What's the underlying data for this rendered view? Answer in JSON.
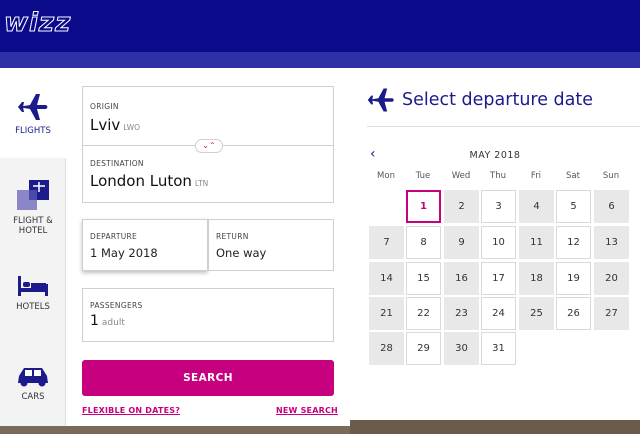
{
  "brand": {
    "logo_text": "wizz"
  },
  "colors": {
    "header": "#0a0a8a",
    "accent": "#c6007e",
    "brand_text": "#1b1b8c"
  },
  "sidebar": {
    "items": [
      {
        "label": "FLIGHTS",
        "icon": "airplane-icon",
        "active": true
      },
      {
        "label": "FLIGHT &\nHOTEL",
        "icon": "flight-hotel-icon",
        "active": false
      },
      {
        "label": "HOTELS",
        "icon": "bed-icon",
        "active": false
      },
      {
        "label": "CARS",
        "icon": "car-icon",
        "active": false
      }
    ]
  },
  "form": {
    "origin": {
      "label": "ORIGIN",
      "city": "Lviv",
      "code": "LWO"
    },
    "destination": {
      "label": "DESTINATION",
      "city": "London Luton",
      "code": "LTN"
    },
    "departure": {
      "label": "DEPARTURE",
      "value": "1 May 2018"
    },
    "return": {
      "label": "RETURN",
      "value": "One way"
    },
    "passengers": {
      "label": "PASSENGERS",
      "count": "1",
      "unit": "adult"
    },
    "swap_glyph": "⌄⌃",
    "search_label": "SEARCH",
    "flexible_link": "FLEXIBLE ON DATES?",
    "new_search_link": "NEW SEARCH"
  },
  "calendar": {
    "title": "Select departure date",
    "month": "MAY 2018",
    "prev_glyph": "‹",
    "weekdays": [
      "Mon",
      "Tue",
      "Wed",
      "Thu",
      "Fri",
      "Sat",
      "Sun"
    ],
    "selected_day": 1,
    "days": [
      {
        "d": "1",
        "s": "sel"
      },
      {
        "d": "2",
        "s": "grey"
      },
      {
        "d": "3",
        "s": "white"
      },
      {
        "d": "4",
        "s": "grey"
      },
      {
        "d": "5",
        "s": "white"
      },
      {
        "d": "6",
        "s": "grey"
      },
      {
        "d": "7",
        "s": "grey"
      },
      {
        "d": "8",
        "s": "white"
      },
      {
        "d": "9",
        "s": "grey"
      },
      {
        "d": "10",
        "s": "white"
      },
      {
        "d": "11",
        "s": "grey"
      },
      {
        "d": "12",
        "s": "white"
      },
      {
        "d": "13",
        "s": "grey"
      },
      {
        "d": "14",
        "s": "grey"
      },
      {
        "d": "15",
        "s": "white"
      },
      {
        "d": "16",
        "s": "grey"
      },
      {
        "d": "17",
        "s": "white"
      },
      {
        "d": "18",
        "s": "grey"
      },
      {
        "d": "19",
        "s": "white"
      },
      {
        "d": "20",
        "s": "grey"
      },
      {
        "d": "21",
        "s": "grey"
      },
      {
        "d": "22",
        "s": "white"
      },
      {
        "d": "23",
        "s": "grey"
      },
      {
        "d": "24",
        "s": "white"
      },
      {
        "d": "25",
        "s": "grey"
      },
      {
        "d": "26",
        "s": "white"
      },
      {
        "d": "27",
        "s": "grey"
      },
      {
        "d": "28",
        "s": "grey"
      },
      {
        "d": "29",
        "s": "white"
      },
      {
        "d": "30",
        "s": "grey"
      },
      {
        "d": "31",
        "s": "white"
      }
    ]
  }
}
